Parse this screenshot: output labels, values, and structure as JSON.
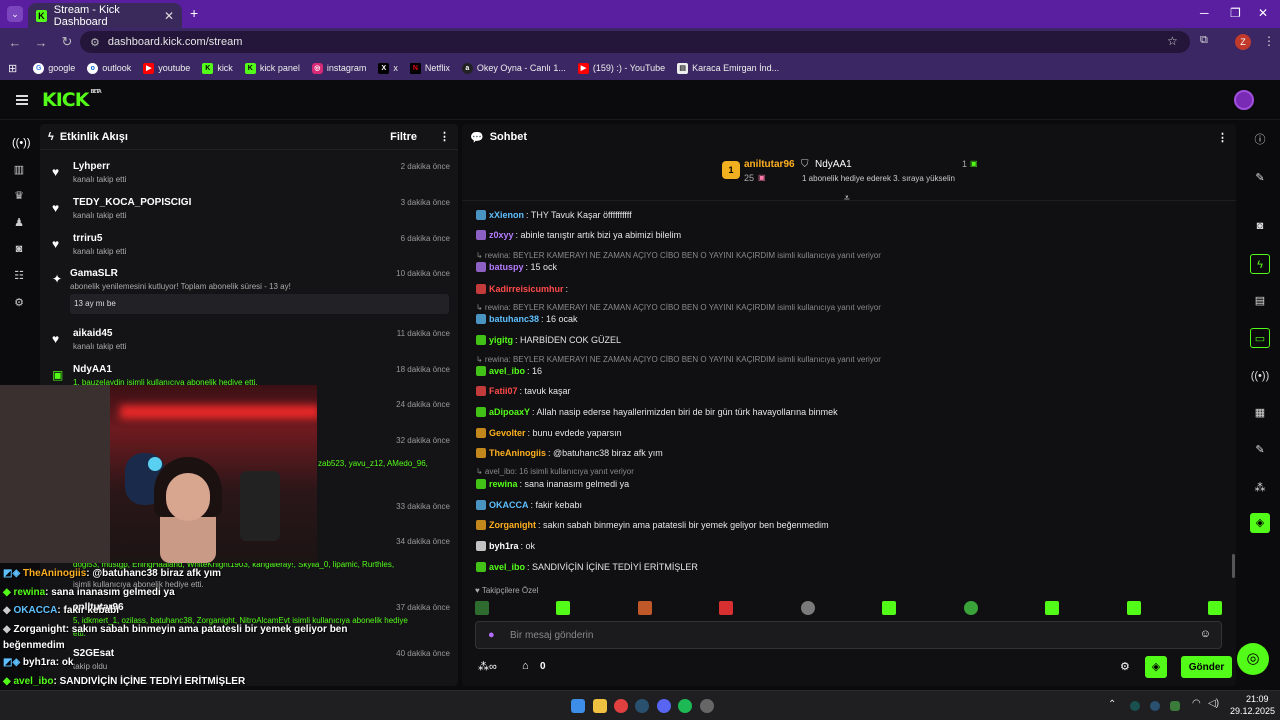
{
  "browser": {
    "tab_title": "Stream - Kick Dashboard",
    "url": "dashboard.kick.com/stream",
    "profile_initial": "Z",
    "bookmarks": [
      "google",
      "outlook",
      "youtube",
      "kick",
      "kick panel",
      "instagram",
      "x",
      "Netflix",
      "Okey Oyna - Canlı 1...",
      "(159) :) - YouTube",
      "Karaca Emirgan İnd..."
    ]
  },
  "brand": {
    "logo": "KICK",
    "beta": "BETA",
    "accent": "#53fc18"
  },
  "activity": {
    "title": "Etkinlik Akışı",
    "filter": "Filtre",
    "items": [
      {
        "name": "Lyhperr",
        "sub": "kanalı takip etti",
        "time": "2 dakika önce"
      },
      {
        "name": "TEDY_KOCA_POPISCIGI",
        "sub": "kanalı takip etti",
        "time": "3 dakika önce"
      },
      {
        "name": "trriru5",
        "sub": "kanalı takip etti",
        "time": "6 dakika önce"
      },
      {
        "name": "GamaSLR",
        "sub": "abonelik yenilemesini kutluyor! Toplam abonelik süresi - 13 ay!",
        "time": "10 dakika önce",
        "note": "13 ay mı be"
      },
      {
        "name": "aikaid45",
        "sub": "kanalı takip etti",
        "time": "11 dakika önce"
      },
      {
        "name": "NdyAA1",
        "sub": "1. bauzelaydin isimli kullanıcıya abonelik hediye etti.",
        "time": "18 dakika önce"
      }
    ],
    "more_times": [
      "24 dakika önce",
      "32 dakika önce",
      "33 dakika önce",
      "34 dakika önce",
      "37 dakika önce",
      "40 dakika önce"
    ],
    "partial_texts": [
      "zab523, yavu_z12, AMedo_96,",
      "dogi53, mustgp, ErlingHaaland, WhiteKnight1903, kangaleray!, Skylla_0, lipamic, Rurthles,",
      "isimli kullanıcıya abonelik hediye etti.",
      "anlltutar96",
      "5, idkmert_1, ozilass, batuhanc38, Zorganight, NitroAlcamEvt isimli kullanıcıya abonelik hediye",
      "etti.",
      "S2GEsat",
      "takip etti",
      "takip oldu"
    ]
  },
  "overlay_chat": [
    {
      "user": "TheAninogiis",
      "text": ": @batuhanc38 biraz afk yım"
    },
    {
      "user": "rewina",
      "text": ": sana inanasım gelmedi ya"
    },
    {
      "user": "OKACCA",
      "text": ": fakir kebabı"
    },
    {
      "user": "Zorganight",
      "text": ": sakın sabah binmeyin ama patatesli bir yemek geliyor ben"
    },
    {
      "user": "",
      "text": "beğenmedim"
    },
    {
      "user": "byh1ra",
      "text": ": ok"
    },
    {
      "user": "avel_ibo",
      "text": ": SANDIVİÇİN İÇİNE TEDİYİ ERİTMİŞLER"
    }
  ],
  "chat": {
    "title": "Sohbet",
    "pinned": {
      "user1": "aniltutar96",
      "count1": "25",
      "user2": "NdyAA1",
      "count2": "1",
      "desc": "1 abonelik hediye ederek 3. sıraya yükselin"
    },
    "messages": [
      {
        "type": "msg",
        "user": "xXienon",
        "color": "#5ec0ff",
        "text": ": THY Tavuk Kaşar öffffffffff"
      },
      {
        "type": "msg",
        "user": "z0xyy",
        "color": "#b57cff",
        "text": ": abinle tanıştır artık bizi ya abimizi bilelim"
      },
      {
        "type": "reply",
        "text": "rewina: BEYLER KAMERAYI NE ZAMAN AÇIYO CİBO BEN O YAYINI KAÇIRDIM isimli kullanıcıya yanıt veriyor"
      },
      {
        "type": "msg",
        "user": "batuspy",
        "color": "#b57cff",
        "text": ": 15 ock"
      },
      {
        "type": "msg",
        "user": "Kadirreisicumhur",
        "color": "#ff4a4a",
        "text": ":"
      },
      {
        "type": "reply",
        "text": "rewina: BEYLER KAMERAYI NE ZAMAN AÇIYO CİBO BEN O YAYINI KAÇIRDIM isimli kullanıcıya yanıt veriyor"
      },
      {
        "type": "msg",
        "user": "batuhanc38",
        "color": "#5ec0ff",
        "text": ": 16 ocak"
      },
      {
        "type": "msg",
        "user": "yigitg",
        "color": "#53fc18",
        "text": ": HARBİDEN COK GÜZEL"
      },
      {
        "type": "reply",
        "text": "rewina: BEYLER KAMERAYI NE ZAMAN AÇIYO CİBO BEN O YAYINI KAÇIRDIM isimli kullanıcıya yanıt veriyor"
      },
      {
        "type": "msg",
        "user": "avel_ibo",
        "color": "#53fc18",
        "text": ": 16"
      },
      {
        "type": "msg",
        "user": "Fatii07",
        "color": "#ff4a4a",
        "text": ": tavuk kaşar"
      },
      {
        "type": "msg",
        "user": "aDipoaxY",
        "color": "#53fc18",
        "text": ": Allah nasip ederse hayallerimizden biri de bir gün türk havayollarına binmek"
      },
      {
        "type": "msg",
        "user": "Gevolter",
        "color": "#ffb020",
        "text": ": bunu evdede yaparsın"
      },
      {
        "type": "msg",
        "user": "TheAninogiis",
        "color": "#ffb020",
        "text": ": @batuhanc38 biraz afk yım"
      },
      {
        "type": "reply",
        "text": "avel_ibo: 16 isimli kullanıcıya yanıt veriyor"
      },
      {
        "type": "msg",
        "user": "rewina",
        "color": "#53fc18",
        "text": ": sana inanasım gelmedi ya"
      },
      {
        "type": "msg",
        "user": "OKACCA",
        "color": "#5ec0ff",
        "text": ": fakir kebabı"
      },
      {
        "type": "msg",
        "user": "Zorganight",
        "color": "#ffb020",
        "text": ": sakın sabah binmeyin ama patatesli bir yemek geliyor ben beğenmedim"
      },
      {
        "type": "msg",
        "user": "byh1ra",
        "color": "#ffffff",
        "text": ": ok"
      },
      {
        "type": "msg",
        "user": "avel_ibo",
        "color": "#53fc18",
        "text": ": SANDIVİÇİN İÇİNE TEDİYİ ERİTMİŞLER"
      }
    ],
    "emote_label": "Takipçilere Özel",
    "input_placeholder": "Bir mesaj gönderin",
    "points": "0",
    "send_label": "Gönder"
  },
  "clock": {
    "time": "21:09",
    "date": "29.12.2025"
  }
}
